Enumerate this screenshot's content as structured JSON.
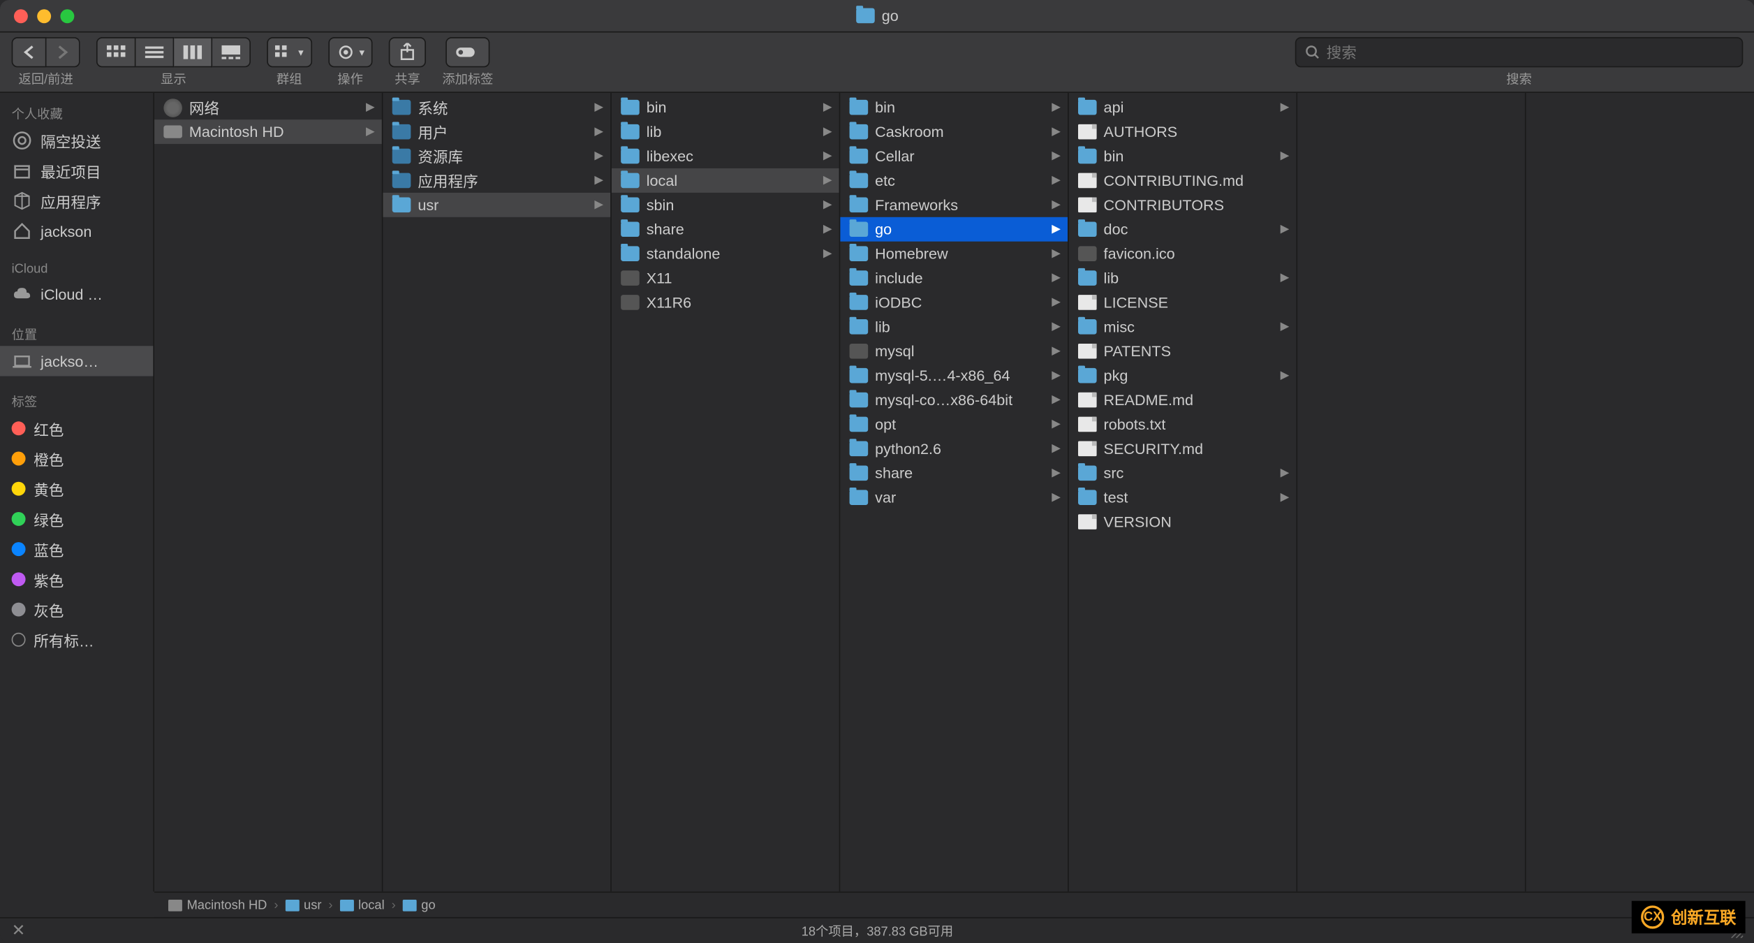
{
  "window": {
    "title": "go"
  },
  "toolbar": {
    "nav_label": "返回/前进",
    "view_label": "显示",
    "group_label": "群组",
    "action_label": "操作",
    "share_label": "共享",
    "tags_label": "添加标签",
    "search_label": "搜索",
    "search_placeholder": "搜索"
  },
  "sidebar": {
    "favorites": {
      "title": "个人收藏",
      "items": [
        {
          "icon": "airdrop",
          "label": "隔空投送"
        },
        {
          "icon": "recents",
          "label": "最近项目"
        },
        {
          "icon": "apps",
          "label": "应用程序"
        },
        {
          "icon": "home",
          "label": "jackson"
        }
      ]
    },
    "icloud": {
      "title": "iCloud",
      "items": [
        {
          "icon": "cloud",
          "label": "iCloud …"
        }
      ]
    },
    "locations": {
      "title": "位置",
      "items": [
        {
          "icon": "laptop",
          "label": "jackso…",
          "selected": true
        }
      ]
    },
    "tags": {
      "title": "标签",
      "items": [
        {
          "color": "#ff5f57",
          "label": "红色"
        },
        {
          "color": "#ff9f0a",
          "label": "橙色"
        },
        {
          "color": "#ffd60a",
          "label": "黄色"
        },
        {
          "color": "#30d158",
          "label": "绿色"
        },
        {
          "color": "#0a84ff",
          "label": "蓝色"
        },
        {
          "color": "#bf5af2",
          "label": "紫色"
        },
        {
          "color": "#8e8e93",
          "label": "灰色"
        },
        {
          "color": "",
          "label": "所有标…"
        }
      ]
    }
  },
  "columns": [
    {
      "items": [
        {
          "icon": "network",
          "label": "网络",
          "arrow": true
        },
        {
          "icon": "hdd",
          "label": "Macintosh HD",
          "arrow": true,
          "selected": "grey"
        }
      ]
    },
    {
      "items": [
        {
          "icon": "folder-sys",
          "label": "系统",
          "arrow": true
        },
        {
          "icon": "folder-sys",
          "label": "用户",
          "arrow": true
        },
        {
          "icon": "folder-sys",
          "label": "资源库",
          "arrow": true
        },
        {
          "icon": "folder-sys",
          "label": "应用程序",
          "arrow": true
        },
        {
          "icon": "folder",
          "label": "usr",
          "arrow": true,
          "selected": "grey"
        }
      ]
    },
    {
      "items": [
        {
          "icon": "folder",
          "label": "bin",
          "arrow": true
        },
        {
          "icon": "folder",
          "label": "lib",
          "arrow": true
        },
        {
          "icon": "folder",
          "label": "libexec",
          "arrow": true
        },
        {
          "icon": "folder",
          "label": "local",
          "arrow": true,
          "selected": "grey"
        },
        {
          "icon": "folder",
          "label": "sbin",
          "arrow": true
        },
        {
          "icon": "folder",
          "label": "share",
          "arrow": true
        },
        {
          "icon": "folder",
          "label": "standalone",
          "arrow": true
        },
        {
          "icon": "alias",
          "label": "X11"
        },
        {
          "icon": "alias",
          "label": "X11R6"
        }
      ]
    },
    {
      "items": [
        {
          "icon": "folder",
          "label": "bin",
          "arrow": true
        },
        {
          "icon": "folder",
          "label": "Caskroom",
          "arrow": true
        },
        {
          "icon": "folder",
          "label": "Cellar",
          "arrow": true
        },
        {
          "icon": "folder",
          "label": "etc",
          "arrow": true
        },
        {
          "icon": "folder",
          "label": "Frameworks",
          "arrow": true
        },
        {
          "icon": "folder",
          "label": "go",
          "arrow": true,
          "selected": "blue"
        },
        {
          "icon": "folder",
          "label": "Homebrew",
          "arrow": true
        },
        {
          "icon": "folder",
          "label": "include",
          "arrow": true
        },
        {
          "icon": "folder",
          "label": "iODBC",
          "arrow": true
        },
        {
          "icon": "folder",
          "label": "lib",
          "arrow": true
        },
        {
          "icon": "alias",
          "label": "mysql",
          "arrow": true
        },
        {
          "icon": "folder",
          "label": "mysql-5.…4-x86_64",
          "arrow": true
        },
        {
          "icon": "folder",
          "label": "mysql-co…x86-64bit",
          "arrow": true
        },
        {
          "icon": "folder",
          "label": "opt",
          "arrow": true
        },
        {
          "icon": "folder",
          "label": "python2.6",
          "arrow": true
        },
        {
          "icon": "folder",
          "label": "share",
          "arrow": true
        },
        {
          "icon": "folder",
          "label": "var",
          "arrow": true
        }
      ]
    },
    {
      "items": [
        {
          "icon": "folder",
          "label": "api",
          "arrow": true
        },
        {
          "icon": "file",
          "label": "AUTHORS"
        },
        {
          "icon": "folder",
          "label": "bin",
          "arrow": true
        },
        {
          "icon": "file",
          "label": "CONTRIBUTING.md"
        },
        {
          "icon": "file",
          "label": "CONTRIBUTORS"
        },
        {
          "icon": "folder",
          "label": "doc",
          "arrow": true
        },
        {
          "icon": "ico",
          "label": "favicon.ico"
        },
        {
          "icon": "folder",
          "label": "lib",
          "arrow": true
        },
        {
          "icon": "file",
          "label": "LICENSE"
        },
        {
          "icon": "folder",
          "label": "misc",
          "arrow": true
        },
        {
          "icon": "file",
          "label": "PATENTS"
        },
        {
          "icon": "folder",
          "label": "pkg",
          "arrow": true
        },
        {
          "icon": "file",
          "label": "README.md"
        },
        {
          "icon": "file",
          "label": "robots.txt"
        },
        {
          "icon": "file",
          "label": "SECURITY.md"
        },
        {
          "icon": "folder",
          "label": "src",
          "arrow": true
        },
        {
          "icon": "folder",
          "label": "test",
          "arrow": true
        },
        {
          "icon": "file",
          "label": "VERSION"
        }
      ]
    },
    {
      "items": []
    }
  ],
  "pathbar": [
    {
      "icon": "hdd",
      "label": "Macintosh HD"
    },
    {
      "icon": "folder",
      "label": "usr"
    },
    {
      "icon": "folder",
      "label": "local"
    },
    {
      "icon": "folder",
      "label": "go"
    }
  ],
  "status": "18个项目，387.83 GB可用",
  "watermark": "创新互联"
}
